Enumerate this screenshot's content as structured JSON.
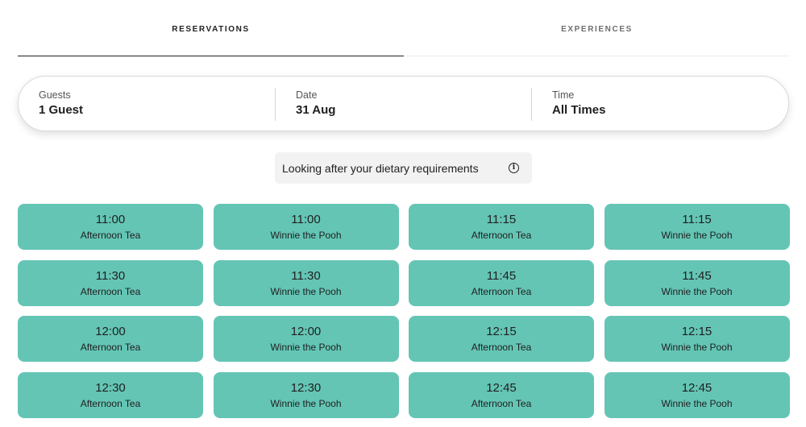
{
  "tabs": [
    {
      "label": "RESERVATIONS",
      "active": true
    },
    {
      "label": "EXPERIENCES",
      "active": false
    }
  ],
  "filters": {
    "guests": {
      "label": "Guests",
      "value": "1 Guest"
    },
    "date": {
      "label": "Date",
      "value": "31 Aug"
    },
    "time": {
      "label": "Time",
      "value": "All Times"
    }
  },
  "dietary": {
    "text": "Looking after your dietary requirements",
    "icon": "info-icon"
  },
  "colors": {
    "slot_background": "#64c5b5",
    "active_tab_underline": "#1f1f1f"
  },
  "slots": [
    {
      "time": "11:00",
      "name": "Afternoon Tea"
    },
    {
      "time": "11:00",
      "name": "Winnie the Pooh"
    },
    {
      "time": "11:15",
      "name": "Afternoon Tea"
    },
    {
      "time": "11:15",
      "name": "Winnie the Pooh"
    },
    {
      "time": "11:30",
      "name": "Afternoon Tea"
    },
    {
      "time": "11:30",
      "name": "Winnie the Pooh"
    },
    {
      "time": "11:45",
      "name": "Afternoon Tea"
    },
    {
      "time": "11:45",
      "name": "Winnie the Pooh"
    },
    {
      "time": "12:00",
      "name": "Afternoon Tea"
    },
    {
      "time": "12:00",
      "name": "Winnie the Pooh"
    },
    {
      "time": "12:15",
      "name": "Afternoon Tea"
    },
    {
      "time": "12:15",
      "name": "Winnie the Pooh"
    },
    {
      "time": "12:30",
      "name": "Afternoon Tea"
    },
    {
      "time": "12:30",
      "name": "Winnie the Pooh"
    },
    {
      "time": "12:45",
      "name": "Afternoon Tea"
    },
    {
      "time": "12:45",
      "name": "Winnie the Pooh"
    }
  ]
}
